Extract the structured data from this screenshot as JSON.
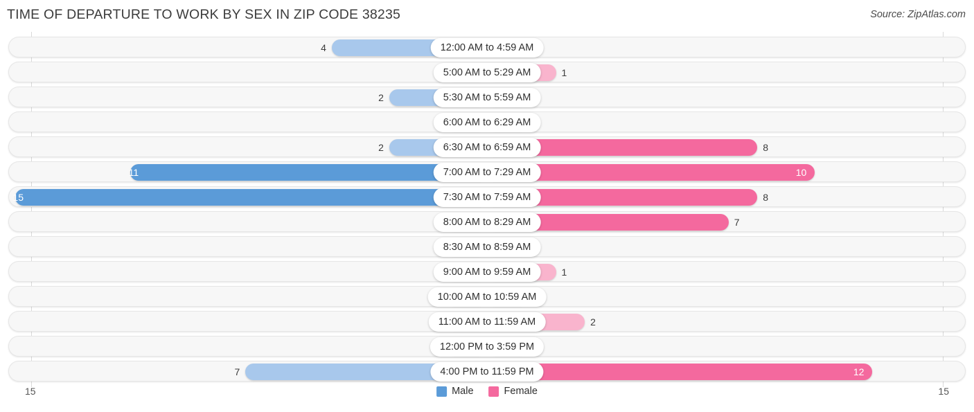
{
  "header": {
    "title": "TIME OF DEPARTURE TO WORK BY SEX IN ZIP CODE 38235",
    "source": "Source: ZipAtlas.com"
  },
  "footer": {
    "axis_left_label": "15",
    "axis_right_label": "15",
    "legend": [
      {
        "label": "Male",
        "color": "#5b9bd8"
      },
      {
        "label": "Female",
        "color": "#f4699e"
      }
    ]
  },
  "colors": {
    "male_dark": "#5b9bd8",
    "male_light": "#a8c8ec",
    "female_dark": "#f4699e",
    "female_light": "#f9b4cd",
    "track": "#f7f7f7",
    "track_border": "#e6e6e6"
  },
  "chart_data": {
    "type": "bar",
    "subtype": "diverging-butterfly",
    "title": "TIME OF DEPARTURE TO WORK BY SEX IN ZIP CODE 38235",
    "xlabel": "",
    "ylabel": "",
    "xlim": [
      15,
      15
    ],
    "axis_max": 15,
    "grid": false,
    "legend_position": "bottom-center",
    "categories": [
      "12:00 AM to 4:59 AM",
      "5:00 AM to 5:29 AM",
      "5:30 AM to 5:59 AM",
      "6:00 AM to 6:29 AM",
      "6:30 AM to 6:59 AM",
      "7:00 AM to 7:29 AM",
      "7:30 AM to 7:59 AM",
      "8:00 AM to 8:29 AM",
      "8:30 AM to 8:59 AM",
      "9:00 AM to 9:59 AM",
      "10:00 AM to 10:59 AM",
      "11:00 AM to 11:59 AM",
      "12:00 PM to 3:59 PM",
      "4:00 PM to 11:59 PM"
    ],
    "series": [
      {
        "name": "Male",
        "direction": "left",
        "values": [
          4,
          0,
          2,
          0,
          2,
          11,
          15,
          0,
          0,
          0,
          0,
          0,
          0,
          7
        ]
      },
      {
        "name": "Female",
        "direction": "right",
        "values": [
          0,
          1,
          0,
          0,
          8,
          10,
          8,
          7,
          0,
          1,
          0,
          2,
          0,
          12
        ]
      }
    ],
    "rows": [
      {
        "category": "12:00 AM to 4:59 AM",
        "male": 4,
        "female": 0,
        "male_label": "4",
        "female_label": "0",
        "male_inside": false,
        "female_inside": false
      },
      {
        "category": "5:00 AM to 5:29 AM",
        "male": 0,
        "female": 1,
        "male_label": "0",
        "female_label": "1",
        "male_inside": false,
        "female_inside": false
      },
      {
        "category": "5:30 AM to 5:59 AM",
        "male": 2,
        "female": 0,
        "male_label": "2",
        "female_label": "0",
        "male_inside": false,
        "female_inside": false
      },
      {
        "category": "6:00 AM to 6:29 AM",
        "male": 0,
        "female": 0,
        "male_label": "0",
        "female_label": "0",
        "male_inside": false,
        "female_inside": false
      },
      {
        "category": "6:30 AM to 6:59 AM",
        "male": 2,
        "female": 8,
        "male_label": "2",
        "female_label": "8",
        "male_inside": false,
        "female_inside": false
      },
      {
        "category": "7:00 AM to 7:29 AM",
        "male": 11,
        "female": 10,
        "male_label": "11",
        "female_label": "10",
        "male_inside": true,
        "female_inside": true
      },
      {
        "category": "7:30 AM to 7:59 AM",
        "male": 15,
        "female": 8,
        "male_label": "15",
        "female_label": "8",
        "male_inside": true,
        "female_inside": false
      },
      {
        "category": "8:00 AM to 8:29 AM",
        "male": 0,
        "female": 7,
        "male_label": "0",
        "female_label": "7",
        "male_inside": false,
        "female_inside": false
      },
      {
        "category": "8:30 AM to 8:59 AM",
        "male": 0,
        "female": 0,
        "male_label": "0",
        "female_label": "0",
        "male_inside": false,
        "female_inside": false
      },
      {
        "category": "9:00 AM to 9:59 AM",
        "male": 0,
        "female": 1,
        "male_label": "0",
        "female_label": "1",
        "male_inside": false,
        "female_inside": false
      },
      {
        "category": "10:00 AM to 10:59 AM",
        "male": 0,
        "female": 0,
        "male_label": "0",
        "female_label": "0",
        "male_inside": false,
        "female_inside": false
      },
      {
        "category": "11:00 AM to 11:59 AM",
        "male": 0,
        "female": 2,
        "male_label": "0",
        "female_label": "2",
        "male_inside": false,
        "female_inside": false
      },
      {
        "category": "12:00 PM to 3:59 PM",
        "male": 0,
        "female": 0,
        "male_label": "0",
        "female_label": "0",
        "male_inside": false,
        "female_inside": false
      },
      {
        "category": "4:00 PM to 11:59 PM",
        "male": 7,
        "female": 12,
        "male_label": "7",
        "female_label": "12",
        "male_inside": false,
        "female_inside": true
      }
    ]
  }
}
